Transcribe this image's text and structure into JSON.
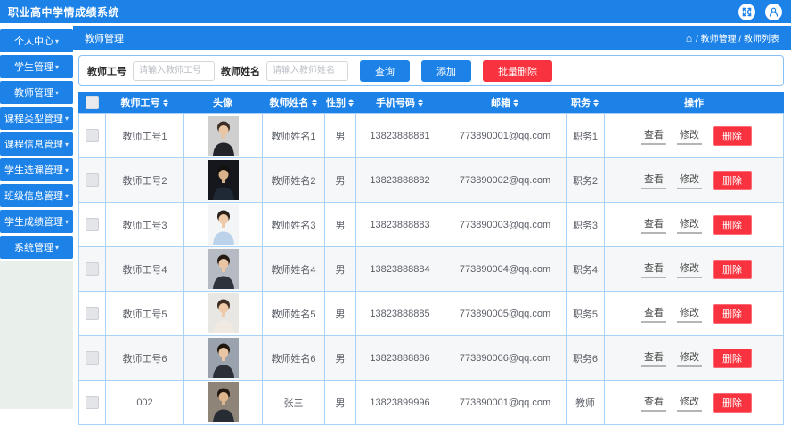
{
  "app": {
    "title": "职业高中学情成绩系统"
  },
  "icons": {
    "home": "⌂",
    "caret_down": "▾"
  },
  "colors": {
    "accent": "#1c82e8",
    "danger": "#f8323e",
    "table_border": "#aad2f6",
    "sidebar_bg": "#e9f0ec"
  },
  "sidebar": {
    "items": [
      {
        "label": "个人中心"
      },
      {
        "label": "学生管理"
      },
      {
        "label": "教师管理"
      },
      {
        "label": "课程类型管理"
      },
      {
        "label": "课程信息管理"
      },
      {
        "label": "学生选课管理"
      },
      {
        "label": "班级信息管理"
      },
      {
        "label": "学生成绩管理"
      },
      {
        "label": "系统管理"
      }
    ]
  },
  "page": {
    "title": "教师管理",
    "breadcrumb": "/ 教师管理 / 教师列表"
  },
  "filters": {
    "teacher_id": {
      "label": "教师工号",
      "placeholder": "请输入教师工号",
      "value": ""
    },
    "teacher_name": {
      "label": "教师姓名",
      "placeholder": "请输入教师姓名",
      "value": ""
    },
    "buttons": {
      "query": "查询",
      "add": "添加",
      "batch_delete": "批量删除"
    }
  },
  "table": {
    "columns": {
      "id": "教师工号",
      "avatar": "头像",
      "name": "教师姓名",
      "gender": "性别",
      "phone": "手机号码",
      "email": "邮箱",
      "position": "职务",
      "actions": "操作"
    },
    "actions": {
      "view": "查看",
      "edit": "修改",
      "delete": "删除"
    },
    "rows": [
      {
        "id": "教师工号1",
        "name": "教师姓名1",
        "gender": "男",
        "phone": "13823888881",
        "email": "773890001@qq.com",
        "position": "职务1",
        "avatar": {
          "bg": "#cfcfcf",
          "hair": "#3a2e26",
          "skin": "#eac5a3",
          "suit": "#23232b"
        }
      },
      {
        "id": "教师工号2",
        "name": "教师姓名2",
        "gender": "男",
        "phone": "13823888882",
        "email": "773890002@qq.com",
        "position": "职务2",
        "avatar": {
          "bg": "#15171d",
          "hair": "#14110e",
          "skin": "#d9b28c",
          "suit": "#1f2835"
        }
      },
      {
        "id": "教师工号3",
        "name": "教师姓名3",
        "gender": "男",
        "phone": "13823888883",
        "email": "773890003@qq.com",
        "position": "职务3",
        "avatar": {
          "bg": "#f3f5f7",
          "hair": "#2a2018",
          "skin": "#efcaa8",
          "suit": "#bcd2ea"
        }
      },
      {
        "id": "教师工号4",
        "name": "教师姓名4",
        "gender": "男",
        "phone": "13823888884",
        "email": "773890004@qq.com",
        "position": "职务4",
        "avatar": {
          "bg": "#b6bac2",
          "hair": "#241a12",
          "skin": "#eac5a3",
          "suit": "#2f333b"
        }
      },
      {
        "id": "教师工号5",
        "name": "教师姓名5",
        "gender": "男",
        "phone": "13823888885",
        "email": "773890005@qq.com",
        "position": "职务5",
        "avatar": {
          "bg": "#e9e7e3",
          "hair": "#3c2e22",
          "skin": "#efcaa8",
          "suit": "#f0eae2"
        }
      },
      {
        "id": "教师工号6",
        "name": "教师姓名6",
        "gender": "男",
        "phone": "13823888886",
        "email": "773890006@qq.com",
        "position": "职务6",
        "avatar": {
          "bg": "#9aa2ad",
          "hair": "#1f150d",
          "skin": "#eac5a3",
          "suit": "#2b2f37"
        }
      },
      {
        "id": "002",
        "name": "张三",
        "gender": "男",
        "phone": "13823899996",
        "email": "773890001@qq.com",
        "position": "教师",
        "avatar": {
          "bg": "#8f8478",
          "hair": "#221a12",
          "skin": "#ddb690",
          "suit": "#272c34"
        }
      }
    ]
  }
}
